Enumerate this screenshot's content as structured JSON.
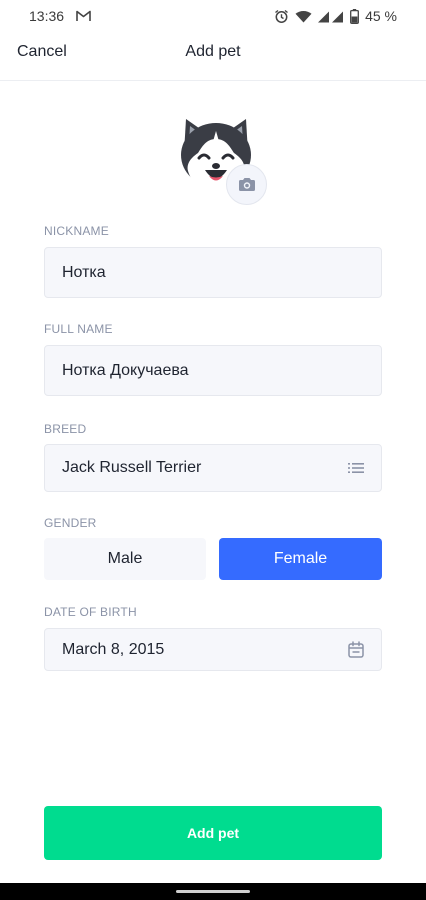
{
  "status_bar": {
    "time": "13:36",
    "battery": "45 %",
    "icons": [
      "gmail-icon",
      "alarm-icon",
      "wifi-icon",
      "signal-icon",
      "battery-icon"
    ]
  },
  "nav": {
    "cancel_label": "Cancel",
    "title": "Add pet"
  },
  "avatar": {
    "icon": "husky-dog-avatar",
    "camera_icon": "camera-icon"
  },
  "form": {
    "nickname": {
      "label": "NICKNAME",
      "value": "Нотка"
    },
    "full_name": {
      "label": "FULL NAME",
      "value": "Нотка Докучаева"
    },
    "breed": {
      "label": "BREED",
      "value": "Jack Russell Terrier",
      "icon": "list-icon"
    },
    "gender": {
      "label": "GENDER",
      "options": [
        "Male",
        "Female"
      ],
      "selected": "Female"
    },
    "date_of_birth": {
      "label": "DATE OF BIRTH",
      "value": "March 8, 2015",
      "icon": "calendar-icon"
    }
  },
  "submit_label": "Add pet",
  "colors": {
    "accent_blue": "#356bff",
    "submit_green": "#00dc8f",
    "label_gray": "#8b93a7",
    "field_bg": "#f6f7fb"
  }
}
